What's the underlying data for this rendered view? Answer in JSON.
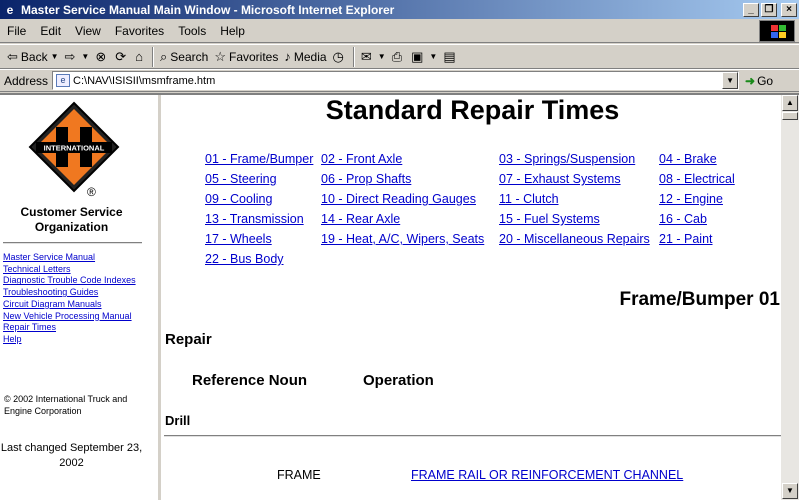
{
  "window": {
    "title": "Master Service Manual Main Window - Microsoft Internet Explorer",
    "minimize": "_",
    "maximize": "❐",
    "close": "×"
  },
  "menu": [
    "File",
    "Edit",
    "View",
    "Favorites",
    "Tools",
    "Help"
  ],
  "toolbar": {
    "back": "Back",
    "search": "Search",
    "favorites": "Favorites",
    "media": "Media"
  },
  "address": {
    "label": "Address",
    "url": "C:\\NAV\\ISISII\\msmframe.htm",
    "go": "Go"
  },
  "sidebar": {
    "registered": "®",
    "org_line1": "Customer Service",
    "org_line2": "Organization",
    "links": [
      "Master Service Manual",
      "Technical Letters",
      "Diagnostic Trouble Code Indexes",
      "Troubleshooting Guides",
      "Circuit Diagram Manuals",
      "New Vehicle Processing Manual",
      "Repair Times",
      "Help"
    ],
    "copyright": "© 2002 International Truck and Engine Corporation",
    "last_changed": "Last changed September 23, 2002",
    "logo_text": "INTERNATIONAL"
  },
  "main": {
    "title": "Standard Repair Times",
    "chapters": [
      [
        "01 - Frame/Bumper",
        "02 - Front Axle",
        "03 - Springs/Suspension",
        "04 - Brake"
      ],
      [
        "05 - Steering",
        "06 - Prop Shafts",
        "07 - Exhaust Systems",
        "08 - Electrical"
      ],
      [
        "09 - Cooling",
        "10 - Direct Reading Gauges",
        "11 - Clutch",
        "12 - Engine"
      ],
      [
        "13 - Transmission",
        "14 - Rear Axle",
        "15 - Fuel Systems",
        "16 - Cab"
      ],
      [
        "17 - Wheels",
        "19 - Heat, A/C, Wipers, Seats",
        "20 - Miscellaneous Repairs",
        "21 - Paint"
      ],
      [
        "22 - Bus Body",
        "",
        "",
        ""
      ]
    ],
    "section_title": "Frame/Bumper 01",
    "repair_label": "Repair",
    "col_reference_noun": "Reference Noun",
    "col_operation": "Operation",
    "drill_label": "Drill",
    "row": {
      "noun": "FRAME",
      "operation": "FRAME RAIL OR REINFORCEMENT CHANNEL"
    }
  },
  "colors": {
    "titlebar_start": "#0a246a",
    "titlebar_end": "#a6caf0",
    "link": "#0000cc",
    "logo_orange": "#f07820",
    "logo_black": "#000000"
  }
}
